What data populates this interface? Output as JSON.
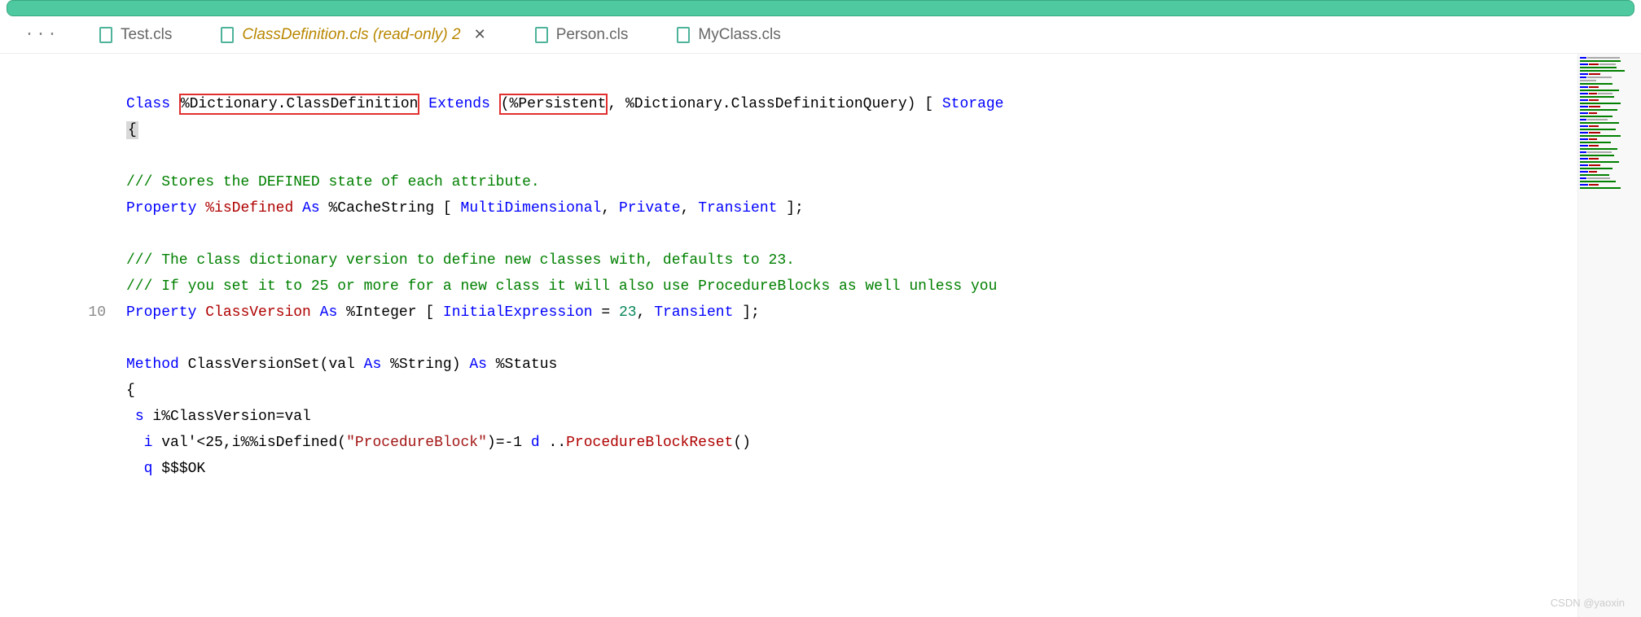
{
  "tabs": [
    {
      "label": "Test.cls",
      "active": false
    },
    {
      "label": "ClassDefinition.cls (read-only) 2",
      "active": true
    },
    {
      "label": "Person.cls",
      "active": false
    },
    {
      "label": "MyClass.cls",
      "active": false
    }
  ],
  "gutter": {
    "line10": "10"
  },
  "code": {
    "l1": {
      "kw_class": "Class",
      "classname": "%Dictionary.ClassDefinition",
      "kw_extends": "Extends",
      "paren_open": "(",
      "super1": "%Persistent",
      "comma": ",",
      "super2": " %Dictionary.ClassDefinitionQuery) [ ",
      "kw_storage": "Storage"
    },
    "l2": {
      "brace": "{"
    },
    "l4": {
      "comment": "/// Stores the DEFINED state of each attribute."
    },
    "l5": {
      "kw_property": "Property",
      "name": "%isDefined",
      "kw_as": "As",
      "type": "%CacheString",
      "bracket_open": " [ ",
      "attr1": "MultiDimensional",
      "c1": ", ",
      "attr2": "Private",
      "c2": ", ",
      "attr3": "Transient",
      "bracket_close": " ];"
    },
    "l7": {
      "comment": "/// The class dictionary version to define new classes with, defaults to 23."
    },
    "l8": {
      "comment": "/// If you set it to 25 or more for a new class it will also use ProcedureBlocks as well unless you"
    },
    "l9": {
      "kw_property": "Property",
      "name": "ClassVersion",
      "kw_as": "As",
      "type": "%Integer",
      "bracket_open": " [ ",
      "attr1": "InitialExpression",
      "eq": " = ",
      "val": "23",
      "c1": ", ",
      "attr2": "Transient",
      "bracket_close": " ];"
    },
    "l11": {
      "kw_method": "Method",
      "name": "ClassVersionSet",
      "sig_open": "(val ",
      "kw_as": "As",
      "argtype": " %String) ",
      "kw_as2": "As",
      "rettype": " %Status"
    },
    "l12": {
      "brace": "{"
    },
    "l13": {
      "cmd_s": "s",
      "expr": " i%ClassVersion=val"
    },
    "l14": {
      "cmd_i": "i",
      "expr1": " val'<25,i%%isDefined(",
      "str": "\"ProcedureBlock\"",
      "expr2": ")=-1 ",
      "cmd_d": "d",
      "call_dots": " ..",
      "call_name": "ProcedureBlockReset",
      "call_end": "()"
    },
    "l15": {
      "cmd_q": "q",
      "macro": " $$$OK"
    }
  },
  "watermark": "CSDN @yaoxin"
}
